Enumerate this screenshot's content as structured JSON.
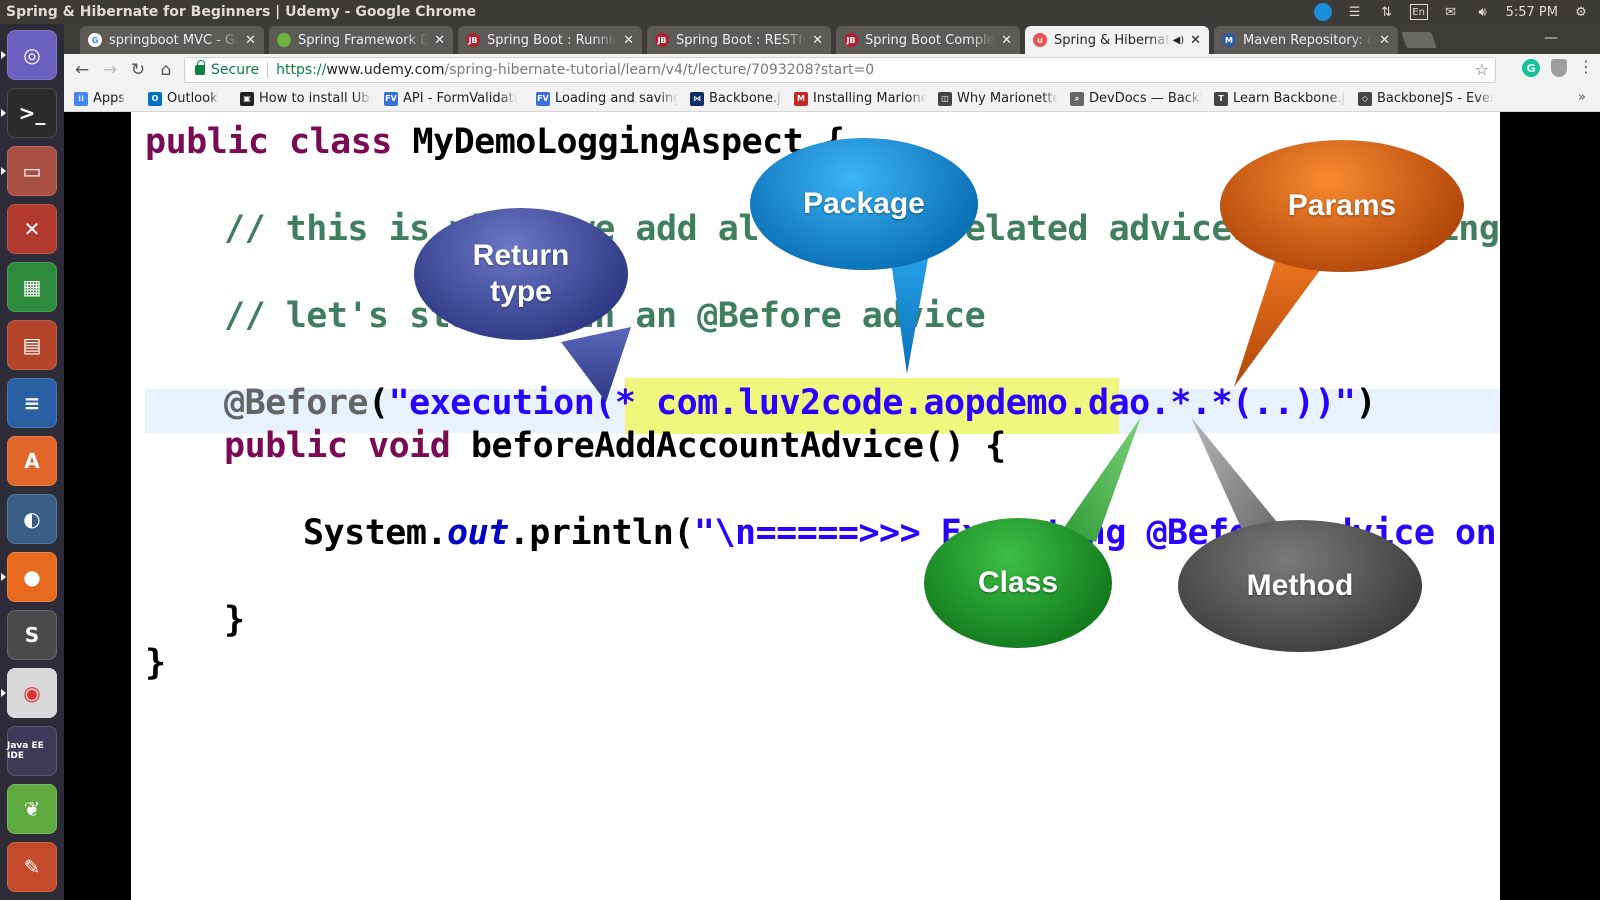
{
  "window": {
    "title": "Spring & Hibernate for Beginners | Udemy - Google Chrome"
  },
  "tray": {
    "keyboard": "En",
    "volume_icon": "volume-icon",
    "clock": "5:57 PM"
  },
  "launcher": {
    "apps": [
      {
        "name": "ubuntu-dash",
        "label": "",
        "color": "#6b5fbf",
        "glyph": "◎"
      },
      {
        "name": "terminal",
        "label": "",
        "color": "#2c2c2c",
        "glyph": ">_"
      },
      {
        "name": "files",
        "label": "",
        "color": "#a94f44",
        "glyph": "▭"
      },
      {
        "name": "system-settings",
        "label": "",
        "color": "#b23a2e",
        "glyph": "✕"
      },
      {
        "name": "libreoffice-calc",
        "label": "",
        "color": "#2e8b3e",
        "glyph": "▦"
      },
      {
        "name": "libreoffice-impress",
        "label": "",
        "color": "#b4452c",
        "glyph": "▤"
      },
      {
        "name": "libreoffice-writer",
        "label": "",
        "color": "#2b5fa4",
        "glyph": "≡"
      },
      {
        "name": "software-center",
        "label": "",
        "color": "#e0662a",
        "glyph": "A"
      },
      {
        "name": "pgadmin",
        "label": "",
        "color": "#3a5f86",
        "glyph": "◐"
      },
      {
        "name": "firefox",
        "label": "",
        "color": "#e86a1f",
        "glyph": "●"
      },
      {
        "name": "sublime-text",
        "label": "",
        "color": "#4a4a4a",
        "glyph": "S"
      },
      {
        "name": "chrome",
        "label": "",
        "color": "#d8d8d8",
        "glyph": "◉"
      },
      {
        "name": "java-ee-ide",
        "label": "Java EE IDE",
        "color": "#3e3a57",
        "glyph": "⚙"
      },
      {
        "name": "spring-tool-suite",
        "label": "",
        "color": "#5eaa3e",
        "glyph": "❦"
      },
      {
        "name": "eclipse-installer",
        "label": "",
        "color": "#c44a2c",
        "glyph": "✎"
      }
    ]
  },
  "tabs": [
    {
      "label": "springboot MVC - Go",
      "favicon_color": "#ffffff",
      "favicon_text": "G",
      "active": false
    },
    {
      "label": "Spring Framework Do",
      "favicon_color": "#6db33f",
      "favicon_text": "",
      "active": false
    },
    {
      "label": "Spring Boot : Running",
      "favicon_color": "#b2202f",
      "favicon_text": "JB",
      "active": false
    },
    {
      "label": "Spring Boot : RESTful",
      "favicon_color": "#b2202f",
      "favicon_text": "JB",
      "active": false
    },
    {
      "label": "Spring Boot Complete",
      "favicon_color": "#b2202f",
      "favicon_text": "JB",
      "active": false
    },
    {
      "label": "Spring & Hibernate",
      "favicon_color": "#ec5252",
      "favicon_text": "u",
      "active": true
    },
    {
      "label": "Maven Repository: o",
      "favicon_color": "#2c5aa8",
      "favicon_text": "M",
      "active": false
    }
  ],
  "omnibox": {
    "secure_label": "Secure",
    "url_scheme": "https://",
    "url_host": "www.udemy.com",
    "url_path": "/spring-hibernate-tutorial/learn/v4/t/lecture/7093208?start=0"
  },
  "bookmarks": [
    {
      "label": "Apps",
      "color": "#4285f4",
      "glyph": "⁞⁞"
    },
    {
      "label": "Outlook",
      "color": "#0072c6",
      "glyph": "O"
    },
    {
      "label": "How to install Ubu",
      "color": "#222222",
      "glyph": "▣"
    },
    {
      "label": "API - FormValidati",
      "color": "#3b6fd8",
      "glyph": "FV"
    },
    {
      "label": "Loading and saving",
      "color": "#3b6fd8",
      "glyph": "FV"
    },
    {
      "label": "Backbone.js",
      "color": "#0d2d6a",
      "glyph": "⋈"
    },
    {
      "label": "Installing Marione",
      "color": "#c62828",
      "glyph": "M"
    },
    {
      "label": "Why Marionette?",
      "color": "#444444",
      "glyph": "◫"
    },
    {
      "label": "DevDocs — Backb",
      "color": "#666666",
      "glyph": "⌕"
    },
    {
      "label": "Learn Backbone.js",
      "color": "#444444",
      "glyph": "T"
    },
    {
      "label": "BackboneJS - Even",
      "color": "#444444",
      "glyph": "◇"
    }
  ],
  "code": {
    "line1_kw": "public class",
    "line1_name": " MyDemoLoggingAspect {",
    "line2": "// this is where we add all of our related advices for logging",
    "line3": "// let's start with an @Before advice",
    "line4_ann": "@Before",
    "line4_paren": "(",
    "line4_str1": "\"execution(* ",
    "line4_pkg": "com.luv2code.aopdemo.dao",
    "line4_str2": ".*.*(..))\"",
    "line4_close": ")",
    "line5_kw": "public void",
    "line5_rest": " beforeAddAccountAdvice() {",
    "line6_pre": "System.",
    "line6_out": "out",
    "line6_mid": ".println(",
    "line6_str": "\"\\n=====>>> Executing @Before advice on method\");",
    "line7": "}",
    "line8": "}"
  },
  "callouts": {
    "return_type": "Return\ntype",
    "package": "Package",
    "params": "Params",
    "class": "Class",
    "method": "Method"
  }
}
